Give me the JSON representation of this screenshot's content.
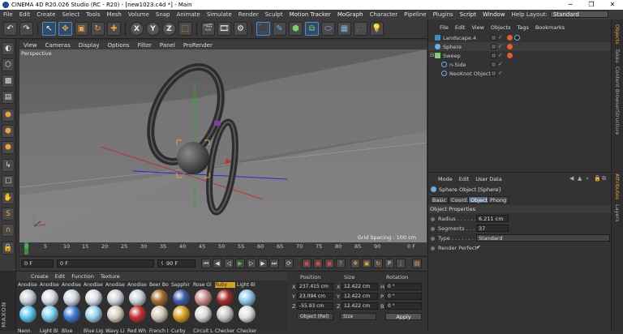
{
  "window": {
    "title": "CINEMA 4D R20.026 Studio (RC - R20) - [new1023.c4d *] - Main"
  },
  "menu": [
    "File",
    "Edit",
    "Create",
    "Select",
    "Tools",
    "Mesh",
    "Volume",
    "Snap",
    "Animate",
    "Simulate",
    "Render",
    "Sculpt",
    "Motion Tracker",
    "MoGraph",
    "Character",
    "Pipeline",
    "Plugins",
    "Script",
    "Window",
    "Help"
  ],
  "layout": {
    "label": "Layout:",
    "value": "Standard"
  },
  "toolbar": {
    "x": "X",
    "y": "Y",
    "z": "Z"
  },
  "viewport": {
    "menu": [
      "View",
      "Cameras",
      "Display",
      "Options",
      "Filter",
      "Panel",
      "ProRender"
    ],
    "label": "Perspective",
    "grid_spacing": "Grid Spacing : 100 cm"
  },
  "timeline": {
    "ticks": [
      "0",
      "5",
      "10",
      "15",
      "20",
      "25",
      "30",
      "35",
      "40",
      "45",
      "50",
      "55",
      "60",
      "65",
      "70",
      "75",
      "80",
      "85",
      "90"
    ],
    "end": "0 F"
  },
  "transport": {
    "start": "0 F",
    "current": "0 F",
    "max": "90 F",
    "end": "90 F"
  },
  "materials": {
    "menu": [
      "Create",
      "Edit",
      "Function",
      "Texture"
    ],
    "row1": [
      "Anodise",
      "Anodise",
      "Anodise",
      "Anodise",
      "Anodise",
      "Anodise",
      "Beer Bo",
      "Sapphir",
      "Rose Gl",
      "Ruby",
      "Light Bl"
    ],
    "row2": [
      "Neon",
      "Light Bl",
      "Blue",
      "Blue Lig",
      "Wavy Li",
      "Red Wh",
      "French I",
      "Curby",
      "Circuit L",
      "Checker",
      "Checker"
    ]
  },
  "coords": {
    "headers": [
      "Position",
      "Size",
      "Rotation"
    ],
    "rows": [
      {
        "axis": "X",
        "pos": "237.415 cm",
        "size_axis": "X",
        "size": "12.422 cm",
        "rot_axis": "H",
        "rot": "0 °"
      },
      {
        "axis": "Y",
        "pos": "23.094 cm",
        "size_axis": "Y",
        "size": "12.422 cm",
        "rot_axis": "P",
        "rot": "0 °"
      },
      {
        "axis": "Z",
        "pos": "-55.93 cm",
        "size_axis": "Z",
        "size": "12.422 cm",
        "rot_axis": "B",
        "rot": "0 °"
      }
    ],
    "mode": "Object (Rel)",
    "size_mode": "Size",
    "apply": "Apply"
  },
  "objects": {
    "menu": [
      "File",
      "Edit",
      "View",
      "Objects",
      "Tags",
      "Bookmarks"
    ],
    "items": [
      {
        "name": "Landscape.4",
        "color": "#9fc7e6"
      },
      {
        "name": "Sphere",
        "color": "#f0a23b"
      },
      {
        "name": "Sweep",
        "color": "#9fc7e6"
      },
      {
        "name": "n-Side",
        "color": "#9fc7e6"
      },
      {
        "name": "NeoKnot Object",
        "color": "#9fc7e6"
      }
    ]
  },
  "attributes": {
    "menu": [
      "Mode",
      "Edit",
      "User Data"
    ],
    "title": "Sphere Object [Sphere]",
    "tabs": [
      "Basic",
      "Coord.",
      "Object",
      "Phong"
    ],
    "section": "Object Properties",
    "radius_label": "Radius . . . . . .",
    "radius": "6.211 cm",
    "segments_label": "Segments . . . .",
    "segments": "37",
    "type_label": "Type . . . . . . . .",
    "type": "Standard",
    "render_perfect_label": "Render Perfect",
    "render_perfect": "✔"
  },
  "rightstrip": [
    "Objects",
    "Takes",
    "Content Browser",
    "Structure",
    "Attributes",
    "Layers"
  ]
}
